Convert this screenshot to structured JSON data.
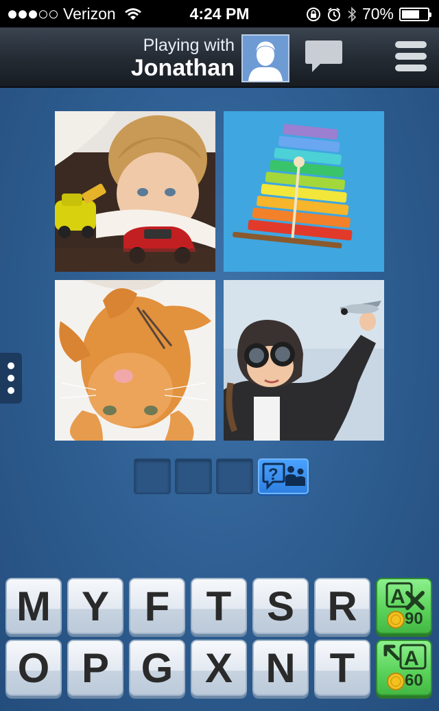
{
  "status_bar": {
    "carrier": "Verizon",
    "signal_bars": 3,
    "time": "4:24 PM",
    "battery": "70%",
    "battery_level": 0.7
  },
  "header": {
    "playing_with": "Playing with",
    "opponent_name": "Jonathan",
    "avatar_icon": "person-silhouette-icon",
    "chat_icon": "chat-bubble-icon",
    "menu_icon": "hamburger-menu-icon"
  },
  "puzzle": {
    "photos": [
      {
        "subject": "boy-with-toy-cars"
      },
      {
        "subject": "rainbow-xylophone"
      },
      {
        "subject": "orange-kitten"
      },
      {
        "subject": "child-aviator-with-toy-plane"
      }
    ],
    "answer_slots": 3,
    "ask_friend_icon": "question-people-icon"
  },
  "keyboard": {
    "row1": [
      "M",
      "Y",
      "F",
      "T",
      "S",
      "R"
    ],
    "row2": [
      "O",
      "P",
      "G",
      "X",
      "N",
      "T"
    ],
    "powerups": [
      {
        "name": "remove-letters",
        "icon": "letter-x-icon",
        "cost": "90"
      },
      {
        "name": "reveal-letter",
        "icon": "reveal-letter-icon",
        "cost": "60"
      }
    ]
  },
  "colors": {
    "background": "#2f5f93",
    "powerup_green": "#5cd45c",
    "ask_blue": "#2e7fe0"
  }
}
